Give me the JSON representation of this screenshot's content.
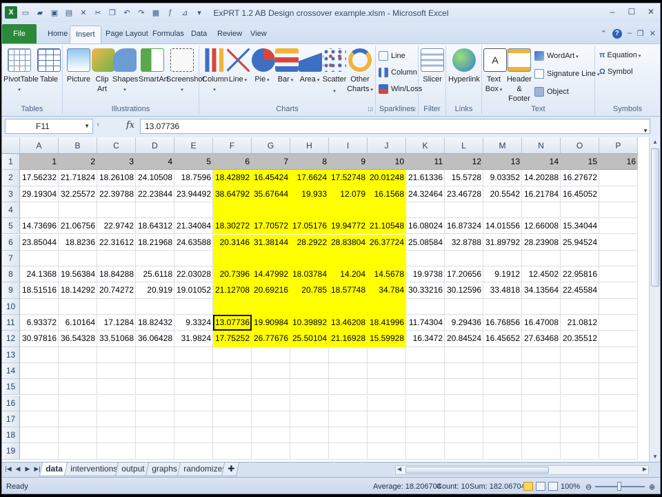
{
  "window": {
    "title": "ExPRT 1.2 AB Design crossover example.xlsm  -  Microsoft Excel",
    "controls": [
      "–",
      "☐",
      "✕"
    ]
  },
  "qat_icons": [
    "excel-logo",
    "new-doc-icon",
    "open-folder-icon",
    "save-icon",
    "print-icon",
    "cut-x-icon",
    "cut-icon",
    "copy-icon",
    "undo-icon",
    "redo-icon",
    "format-icon",
    "fx-icon",
    "filter-icon",
    "more-icon"
  ],
  "tabs": [
    {
      "label": "File"
    },
    {
      "label": "Home"
    },
    {
      "label": "Insert"
    },
    {
      "label": "Page Layout"
    },
    {
      "label": "Formulas"
    },
    {
      "label": "Data"
    },
    {
      "label": "Review"
    },
    {
      "label": "View"
    }
  ],
  "ribbon": {
    "groups": {
      "tables": "Tables",
      "illustrations": "Illustrations",
      "charts": "Charts",
      "sparklines": "Sparklines",
      "filter": "Filter",
      "links": "Links",
      "text": "Text",
      "symbols": "Symbols"
    },
    "buttons": {
      "pivot": "PivotTable",
      "table": "Table",
      "picture": "Picture",
      "clipart1": "Clip",
      "clipart2": "Art",
      "shapes": "Shapes",
      "smartart": "SmartArt",
      "screenshot": "Screenshot",
      "column": "Column",
      "line": "Line",
      "pie": "Pie",
      "bar": "Bar",
      "area": "Area",
      "scatter": "Scatter",
      "other1": "Other",
      "other2": "Charts",
      "sp_line": "Line",
      "sp_column": "Column",
      "sp_winloss": "Win/Loss",
      "slicer": "Slicer",
      "hyperlink": "Hyperlink",
      "textbox1": "Text",
      "textbox2": "Box",
      "header1": "Header",
      "header2": "& Footer",
      "wordart": "WordArt",
      "signature": "Signature Line",
      "object": "Object",
      "equation": "Equation",
      "symbol": "Symbol"
    }
  },
  "formula": {
    "name_box": "F11",
    "fx": "fx",
    "value": "13.07736"
  },
  "columns": [
    "A",
    "B",
    "C",
    "D",
    "E",
    "F",
    "G",
    "H",
    "I",
    "J",
    "K",
    "L",
    "M",
    "N",
    "O",
    "P"
  ],
  "rows": [
    [
      "1",
      "2",
      "3",
      "4",
      "5",
      "6",
      "7",
      "8",
      "9",
      "10",
      "11",
      "12",
      "13",
      "14",
      "15",
      "16"
    ],
    [
      "17.56232",
      "21.71824",
      "18.26108",
      "24.10508",
      "18.7596",
      "18.42892",
      "16.45424",
      "17.6624",
      "17.52748",
      "20.01248",
      "21.61336",
      "15.5728",
      "9.03352",
      "14.20288",
      "16.27672",
      ""
    ],
    [
      "29.19304",
      "32.25572",
      "22.39788",
      "22.23844",
      "23.94492",
      "38.64792",
      "35.67644",
      "19.933",
      "12.079",
      "16.1568",
      "24.32464",
      "23.46728",
      "20.5542",
      "16.21784",
      "16.45052",
      ""
    ],
    [
      "",
      "",
      "",
      "",
      "",
      "",
      "",
      "",
      "",
      "",
      "",
      "",
      "",
      "",
      "",
      ""
    ],
    [
      "14.73696",
      "21.06756",
      "22.9742",
      "18.64312",
      "21.34084",
      "18.30272",
      "17.70572",
      "17.05176",
      "19.94772",
      "21.10548",
      "16.08024",
      "16.87324",
      "14.01556",
      "12.66008",
      "15.34044",
      ""
    ],
    [
      "23.85044",
      "18.8236",
      "22.31612",
      "18.21968",
      "24.63588",
      "20.3146",
      "31.38144",
      "28.2922",
      "28.83804",
      "26.37724",
      "25.08584",
      "32.8788",
      "31.89792",
      "28.23908",
      "25.94524",
      ""
    ],
    [
      "",
      "",
      "",
      "",
      "",
      "",
      "",
      "",
      "",
      "",
      "",
      "",
      "",
      "",
      "",
      ""
    ],
    [
      "24.1368",
      "19.56384",
      "18.84288",
      "25.6118",
      "22.03028",
      "20.7396",
      "14.47992",
      "18.03784",
      "14.204",
      "14.5678",
      "19.9738",
      "17.20656",
      "9.1912",
      "12.4502",
      "22.95816",
      ""
    ],
    [
      "18.51516",
      "18.14292",
      "20.74272",
      "20.919",
      "19.01052",
      "21.12708",
      "20.69216",
      "20.785",
      "18.57748",
      "34.784",
      "30.33216",
      "30.12596",
      "33.4818",
      "34.13564",
      "22.45584",
      ""
    ],
    [
      "",
      "",
      "",
      "",
      "",
      "",
      "",
      "",
      "",
      "",
      "",
      "",
      "",
      "",
      "",
      ""
    ],
    [
      "6.93372",
      "6.10164",
      "17.1284",
      "18.82432",
      "9.3324",
      "13.07736",
      "19.90984",
      "10.39892",
      "13.46208",
      "18.41996",
      "11.74304",
      "9.29436",
      "16.76856",
      "16.47008",
      "21.0812",
      ""
    ],
    [
      "30.97816",
      "36.54328",
      "33.51068",
      "36.06428",
      "31.9824",
      "17.75252",
      "26.77676",
      "25.50104",
      "21.16928",
      "15.59928",
      "16.3472",
      "20.84524",
      "16.45652",
      "27.63468",
      "20.35512",
      ""
    ],
    [
      "",
      "",
      "",
      "",
      "",
      "",
      "",
      "",
      "",
      "",
      "",
      "",
      "",
      "",
      "",
      ""
    ],
    [
      "",
      "",
      "",
      "",
      "",
      "",
      "",
      "",
      "",
      "",
      "",
      "",
      "",
      "",
      "",
      ""
    ],
    [
      "",
      "",
      "",
      "",
      "",
      "",
      "",
      "",
      "",
      "",
      "",
      "",
      "",
      "",
      "",
      ""
    ],
    [
      "",
      "",
      "",
      "",
      "",
      "",
      "",
      "",
      "",
      "",
      "",
      "",
      "",
      "",
      "",
      ""
    ],
    [
      "",
      "",
      "",
      "",
      "",
      "",
      "",
      "",
      "",
      "",
      "",
      "",
      "",
      "",
      "",
      ""
    ],
    [
      "",
      "",
      "",
      "",
      "",
      "",
      "",
      "",
      "",
      "",
      "",
      "",
      "",
      "",
      "",
      ""
    ],
    [
      "",
      "",
      "",
      "",
      "",
      "",
      "",
      "",
      "",
      "",
      "",
      "",
      "",
      "",
      "",
      ""
    ]
  ],
  "sheets": [
    {
      "label": "data",
      "active": true
    },
    {
      "label": "interventions",
      "active": false
    },
    {
      "label": "output",
      "active": false
    },
    {
      "label": "graphs",
      "active": false
    },
    {
      "label": "randomizer",
      "active": false
    }
  ],
  "status": {
    "ready": "Ready",
    "average": "Average: 18.206704",
    "count": "Count: 10",
    "sum": "Sum: 182.06704",
    "zoom": "100%"
  },
  "colors": {
    "highlight": "#ffff00",
    "header_row": "#bfbfbf",
    "file_tab": "#2a8a3a"
  }
}
